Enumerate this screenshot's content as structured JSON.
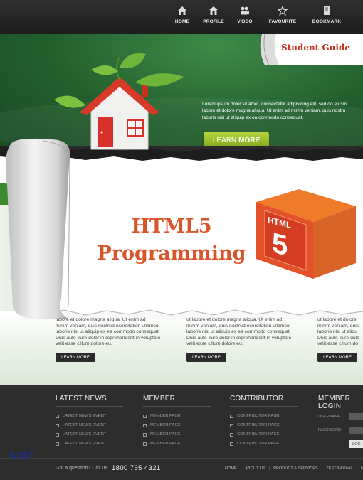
{
  "nav": {
    "items": [
      {
        "label": "HOME",
        "icon": "home-icon"
      },
      {
        "label": "PROFILE",
        "icon": "profile-icon"
      },
      {
        "label": "VIDEO",
        "icon": "video-icon"
      },
      {
        "label": "FAVOURITE",
        "icon": "star-icon"
      },
      {
        "label": "BOOKMARK",
        "icon": "bookmark-icon"
      }
    ]
  },
  "hero": {
    "corner_label": "Student Guide",
    "text_lines": [
      "Lorem ipsum dolor sit amet, consectetur adipisicing elit, sed do eiusm",
      "labore et dolore magna aliqua. Ut enim ad minim veniam, quis nostru",
      "laboris nisi ut aliquip ex ea commodo consequat."
    ],
    "button_light": "LEARN",
    "button_bold": "MORE"
  },
  "book": {
    "title_line1": "HTML5",
    "title_line2": "Programming",
    "cube_label": "HTML",
    "cube_number": "5"
  },
  "columns": [
    {
      "lines": [
        "labore et dolore magna aliqua. Ut enim ad",
        "minim veniam, quis nostrud exercitation ullamco",
        "laboris nisi ut aliquip ex ea commodo consequat.",
        "Duis aute irure dolor in reprehenderit in voluptate",
        "velit esse cillum dolore eu."
      ],
      "button": "LEARN MORE"
    },
    {
      "lines": [
        "ut labore et dolore magna aliqua. Ut enim ad",
        "minim veniam, quis nostrud exercitation ullamco",
        "laboris nisi ut aliquip ex ea commodo consequat.",
        "Duis aute irure dolor in reprehenderit in voluptate",
        "velit esse cillum dolore eu."
      ],
      "button": "LEARN MORE"
    },
    {
      "lines": [
        "ut labore et dolore",
        "minim veniam, quis",
        "laboris nisi ut aliqu",
        "Duis aute irure dolo",
        "velit esse cillum do"
      ],
      "button": "LEARN MORE"
    }
  ],
  "footer": {
    "latest_news": {
      "heading": "LATEST NEWS",
      "items": [
        "LATEST NEWS EVENT",
        "LATEST NEWS EVENT",
        "LATEST NEWS EVENT",
        "LATEST NEWS EVENT"
      ]
    },
    "member": {
      "heading": "MEMBER",
      "items": [
        "MEMBER PAGE",
        "MEMBER PAGE",
        "MEMBER PAGE",
        "MEMBER PAGE"
      ]
    },
    "contributor": {
      "heading": "CONTRIBUTOR",
      "items": [
        "CONTRIBUTOR PAGE",
        "CONTRIBUTOR PAGE",
        "CONTRIBUTOR PAGE",
        "CONTRIBUTOR PAGE"
      ]
    },
    "login": {
      "heading": "MEMBER LOGIN",
      "username_label": "USERNAME",
      "password_label": "PASSWORD",
      "button": "LOG"
    },
    "question": "Got a question? Call us",
    "phone": "1800 765 4321",
    "links": [
      "HOME",
      "ABOUT US",
      "PRODUCT & SERVICES",
      "TESTIMONIAL",
      "N"
    ]
  },
  "publisher": "NIIT",
  "colors": {
    "title_orange": "#d9542a",
    "hero_green": "#235f2d",
    "button_green": "#8db520",
    "footer_dark": "#2d2d2d",
    "niit_blue": "#1d2c86"
  }
}
